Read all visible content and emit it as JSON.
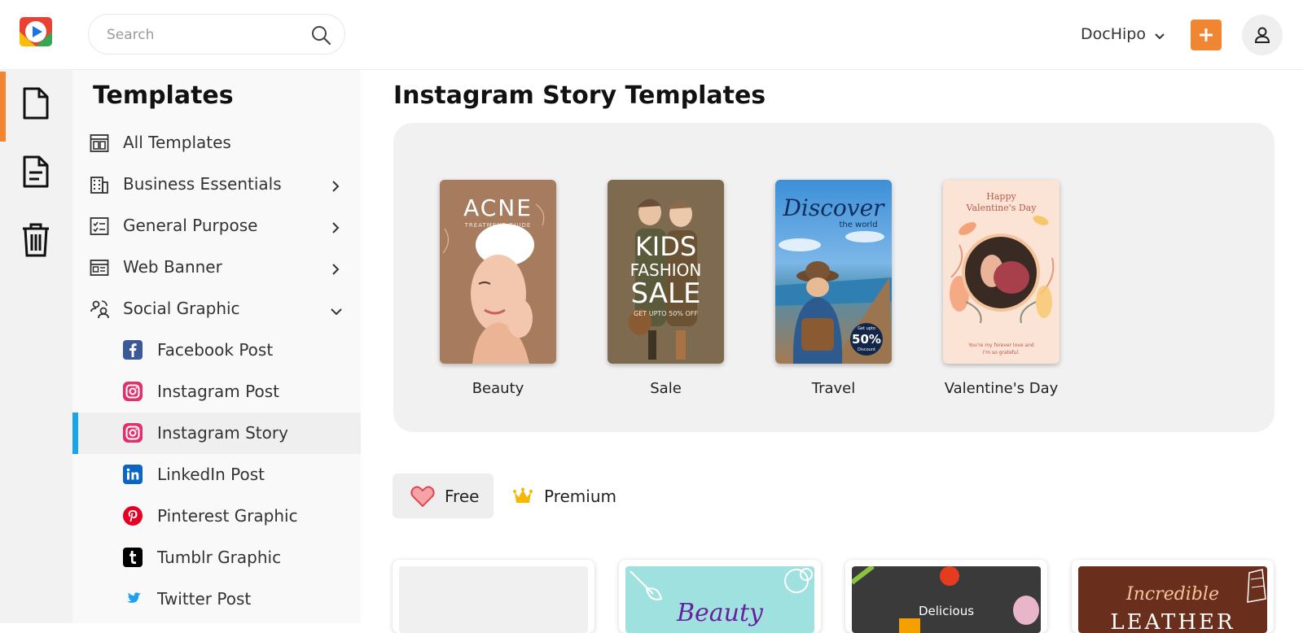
{
  "header": {
    "search_placeholder": "Search",
    "workspace": "DocHipo",
    "icons": {
      "logo": "dochipo-logo",
      "search": "search-icon",
      "add": "plus-icon",
      "avatar": "user-icon"
    },
    "accent_color": "#f08532"
  },
  "rail": {
    "items": [
      {
        "name": "templates",
        "icon": "document-icon"
      },
      {
        "name": "documents",
        "icon": "file-text-icon"
      },
      {
        "name": "trash",
        "icon": "trash-icon"
      }
    ]
  },
  "sidebar": {
    "title": "Templates",
    "items": [
      {
        "label": "All Templates",
        "icon": "layout-icon"
      },
      {
        "label": "Business Essentials",
        "icon": "building-icon"
      },
      {
        "label": "General Purpose",
        "icon": "checklist-icon"
      },
      {
        "label": "Web Banner",
        "icon": "banner-icon"
      },
      {
        "label": "Social Graphic",
        "icon": "social-icon"
      }
    ],
    "sub_items": [
      {
        "label": "Facebook Post",
        "icon": "facebook-icon"
      },
      {
        "label": "Instagram Post",
        "icon": "instagram-icon"
      },
      {
        "label": "Instagram Story",
        "icon": "instagram-icon",
        "active": true
      },
      {
        "label": "LinkedIn Post",
        "icon": "linkedin-icon"
      },
      {
        "label": "Pinterest Graphic",
        "icon": "pinterest-icon"
      },
      {
        "label": "Tumblr Graphic",
        "icon": "tumblr-icon"
      },
      {
        "label": "Twitter Post",
        "icon": "twitter-icon"
      }
    ]
  },
  "main": {
    "title": "Instagram Story Templates",
    "featured": [
      {
        "caption": "Beauty",
        "thumb_title": "ACNE",
        "thumb_sub": "TREATMENT GUIDE"
      },
      {
        "caption": "Sale",
        "thumb_title": "KIDS",
        "thumb_line2": "FASHION",
        "thumb_line3": "SALE",
        "thumb_sub": "GET UPTO 50% OFF"
      },
      {
        "caption": "Travel",
        "thumb_title": "Discover",
        "thumb_sub": "the world",
        "badge_top": "Get upto",
        "badge": "50%",
        "badge_bottom": "Discount"
      },
      {
        "caption": "Valentine's Day",
        "thumb_title": "Happy",
        "thumb_line2": "Valentine's Day",
        "thumb_sub": "You're my forever love and",
        "thumb_sub2": "I'm so grateful."
      }
    ],
    "filters": [
      {
        "label": "Free",
        "icon": "heart-icon",
        "active": true
      },
      {
        "label": "Premium",
        "icon": "crown-icon",
        "active": false
      }
    ],
    "grid_texts": {
      "beauty": "Beauty",
      "delicious": "Delicious",
      "incredible": "Incredible",
      "leather": "LEATHER"
    }
  }
}
